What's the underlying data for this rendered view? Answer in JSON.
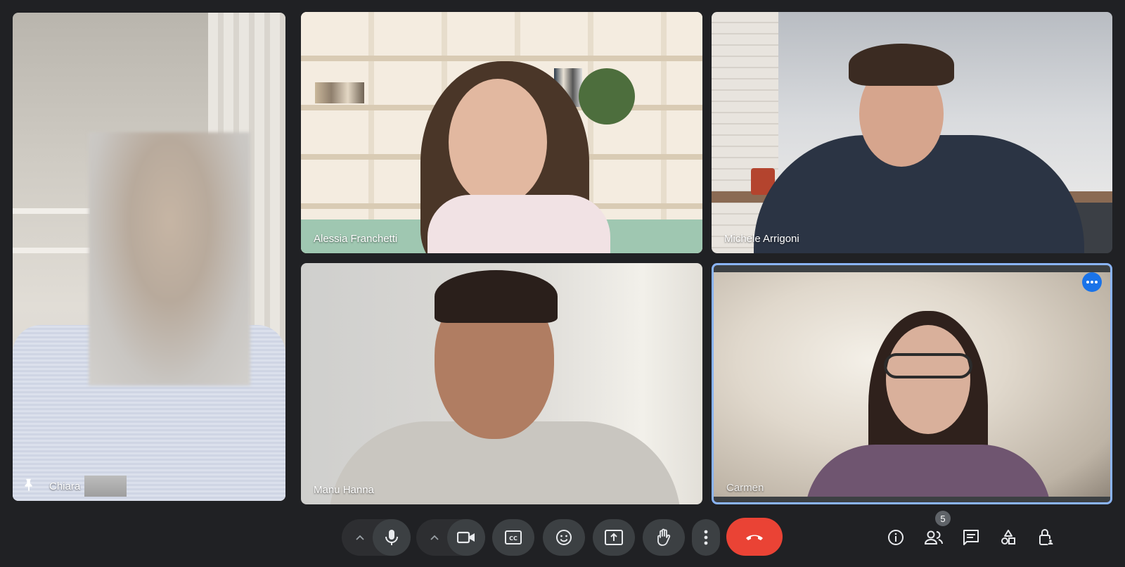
{
  "participants": [
    {
      "name": "Chiara",
      "pinned": true
    },
    {
      "name": "Alessia Franchetti"
    },
    {
      "name": "Michele Arrigoni"
    },
    {
      "name": "Manu Hanna"
    },
    {
      "name": "Carmen",
      "active": true
    }
  ],
  "controls": {
    "mic": "mic-icon",
    "camera": "camera-icon",
    "captions": "captions-icon",
    "reactions": "emoji-icon",
    "present": "present-icon",
    "raise_hand": "hand-icon",
    "more": "more-vert-icon",
    "end_call": "end-call-icon"
  },
  "right_controls": {
    "people_count": "5"
  },
  "colors": {
    "background": "#202124",
    "end_call": "#ea4335",
    "active_border": "#8ab4f8",
    "more_button": "#1a73e8"
  }
}
